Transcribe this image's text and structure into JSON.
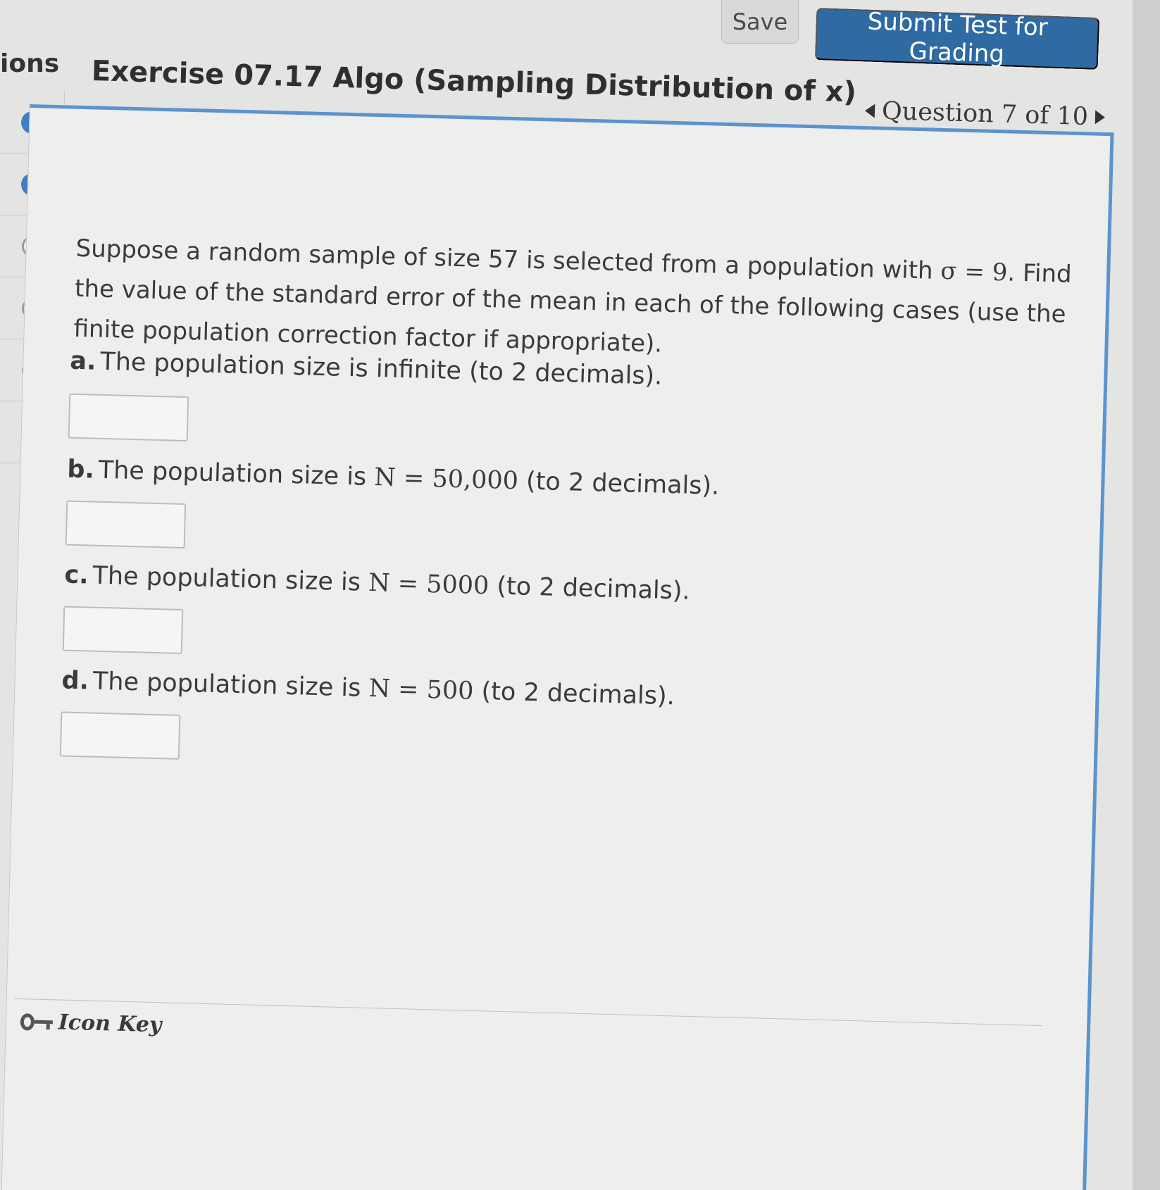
{
  "toolbar": {
    "save_label": "Save",
    "submit_label": "Submit Test for Grading"
  },
  "nav": {
    "header": "ions",
    "items": [
      {
        "state": "answered"
      },
      {
        "state": "answered"
      },
      {
        "state": "unanswered"
      },
      {
        "state": "unanswered"
      },
      {
        "state": "unanswered"
      },
      {
        "state": "unanswered"
      }
    ]
  },
  "exercise": {
    "title": "Exercise 07.17 Algo (Sampling Distribution of x)",
    "question_nav": "Question 7 of 10"
  },
  "question": {
    "intro_1": "Suppose a random sample of size 57 is selected from a population with",
    "sigma_expr": "σ = 9",
    "intro_2": ". Find the value of the standard error of the mean in each of the following cases (use the finite population correction factor if appropriate).",
    "parts": [
      {
        "letter": "a.",
        "text_before": "The population size is infinite (to 2 decimals).",
        "N": "",
        "text_after": ""
      },
      {
        "letter": "b.",
        "text_before": "The population size is",
        "N": "N = 50,000",
        "text_after": "(to 2 decimals)."
      },
      {
        "letter": "c.",
        "text_before": "The population size is",
        "N": "N = 5000",
        "text_after": "(to 2 decimals)."
      },
      {
        "letter": "d.",
        "text_before": "The population size is",
        "N": "N = 500",
        "text_after": "(to 2 decimals)."
      }
    ]
  },
  "footer": {
    "icon_key_label": "Icon Key"
  },
  "colors": {
    "accent": "#2f6aa3",
    "panel_border": "#5b93cf",
    "answered_dot": "#3f7fc2"
  }
}
